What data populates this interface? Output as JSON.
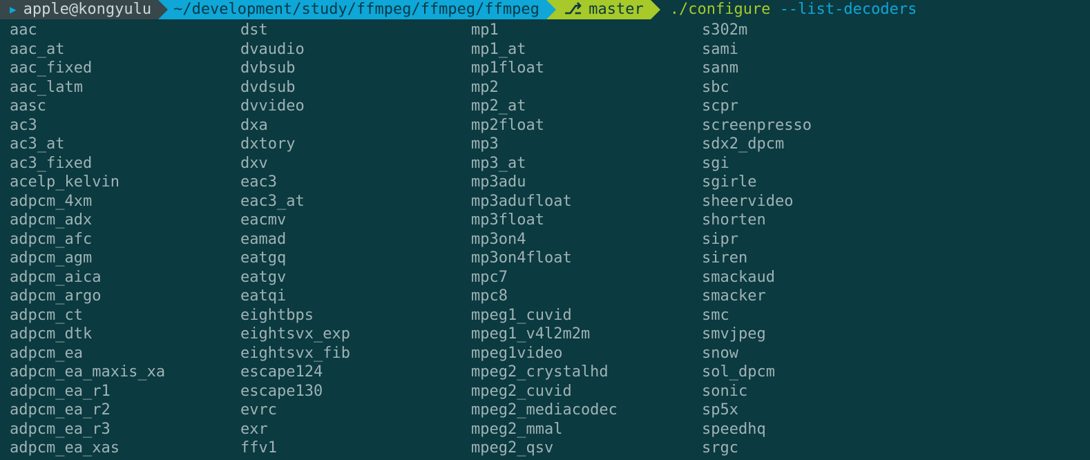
{
  "prompt": {
    "user": "apple@kongyulu",
    "path": "~/development/study/ffmpeg/ffmpeg/ffmpeg",
    "branch": "master",
    "git_icon": "⎇",
    "command_exec": "./configure",
    "command_arg": "--list-decoders"
  },
  "columns": [
    [
      "aac",
      "aac_at",
      "aac_fixed",
      "aac_latm",
      "aasc",
      "ac3",
      "ac3_at",
      "ac3_fixed",
      "acelp_kelvin",
      "adpcm_4xm",
      "adpcm_adx",
      "adpcm_afc",
      "adpcm_agm",
      "adpcm_aica",
      "adpcm_argo",
      "adpcm_ct",
      "adpcm_dtk",
      "adpcm_ea",
      "adpcm_ea_maxis_xa",
      "adpcm_ea_r1",
      "adpcm_ea_r2",
      "adpcm_ea_r3",
      "adpcm_ea_xas"
    ],
    [
      "dst",
      "dvaudio",
      "dvbsub",
      "dvdsub",
      "dvvideo",
      "dxa",
      "dxtory",
      "dxv",
      "eac3",
      "eac3_at",
      "eacmv",
      "eamad",
      "eatgq",
      "eatgv",
      "eatqi",
      "eightbps",
      "eightsvx_exp",
      "eightsvx_fib",
      "escape124",
      "escape130",
      "evrc",
      "exr",
      "ffv1"
    ],
    [
      "mp1",
      "mp1_at",
      "mp1float",
      "mp2",
      "mp2_at",
      "mp2float",
      "mp3",
      "mp3_at",
      "mp3adu",
      "mp3adufloat",
      "mp3float",
      "mp3on4",
      "mp3on4float",
      "mpc7",
      "mpc8",
      "mpeg1_cuvid",
      "mpeg1_v4l2m2m",
      "mpeg1video",
      "mpeg2_crystalhd",
      "mpeg2_cuvid",
      "mpeg2_mediacodec",
      "mpeg2_mmal",
      "mpeg2_qsv"
    ],
    [
      "s302m",
      "sami",
      "sanm",
      "sbc",
      "scpr",
      "screenpresso",
      "sdx2_dpcm",
      "sgi",
      "sgirle",
      "sheervideo",
      "shorten",
      "sipr",
      "siren",
      "smackaud",
      "smacker",
      "smc",
      "smvjpeg",
      "snow",
      "sol_dpcm",
      "sonic",
      "sp5x",
      "speedhq",
      "srgc"
    ]
  ]
}
